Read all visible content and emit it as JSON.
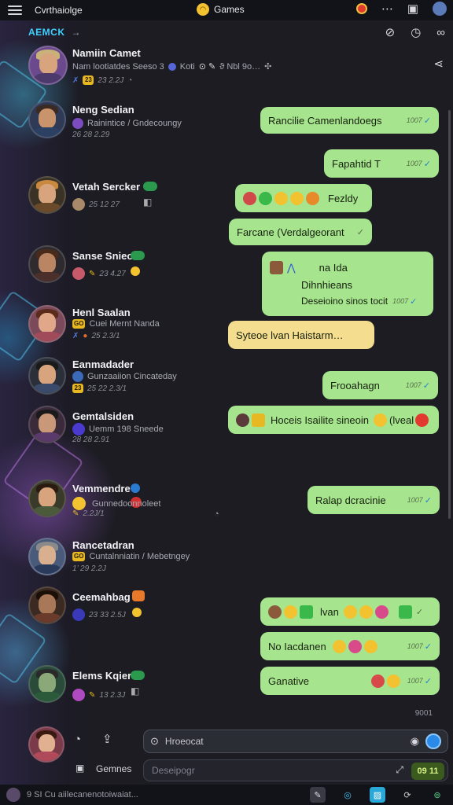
{
  "status_bar": {
    "app_name": "Cvrthaiolge",
    "center_title": "Games",
    "icons": [
      "menu-icon",
      "record-icon",
      "more-icon",
      "window-icon",
      "profile-icon"
    ]
  },
  "header": {
    "tag": "AEMCK",
    "tag_suffix": "→",
    "title": "Namiin Camet",
    "subtitle": "Nam lootiatdes Seeso 3",
    "subtitle_extra": "Koti",
    "subtitle_more": "ϑ Nbl 9o…",
    "meta": "23 2.2J",
    "icons": [
      "edit-icon",
      "clock-icon",
      "infinity-icon",
      "share-icon"
    ]
  },
  "contacts": [
    {
      "name": "Neng Sedian",
      "sub": "Rainintice / Gndecoungy",
      "meta": "26 28 2.29"
    },
    {
      "name": "Vetah Sercker",
      "sub": "",
      "meta": "25 12 27"
    },
    {
      "name": "Sanse Snieo",
      "sub": "",
      "meta": "23 4.27"
    },
    {
      "name": "Henl Saalan",
      "sub": "Cuei Mernt Nanda",
      "meta": "25 2.3/1"
    },
    {
      "name": "Eanmadader",
      "sub": "Gunzaaiion Cincateday",
      "meta": "25 22 2.3/1"
    },
    {
      "name": "Gemtalsiden",
      "sub": "Uemm 198 Sneede",
      "meta": "28 28 2.91"
    },
    {
      "name": "Vemmendre",
      "sub": "Gunnedoonnoleet",
      "meta": "2.2J/1"
    },
    {
      "name": "Rancetadran",
      "sub": "Cuntalnniatin / Mebetngey",
      "meta": "1’ 29 2.2J"
    },
    {
      "name": "Ceemahbag",
      "sub": "",
      "meta": "23 33 2.5J"
    },
    {
      "name": "Elems Kqier",
      "sub": "",
      "meta": "13 2.3J"
    }
  ],
  "messages": [
    {
      "text": "Rancilie Camenlandoegs",
      "time": "1007",
      "style": "green"
    },
    {
      "text": "Fapahtid T",
      "time": "1007",
      "style": "green"
    },
    {
      "text": "Fezldy",
      "time": "",
      "style": "green"
    },
    {
      "text": "Farcane (Verdalgeorant",
      "time": "",
      "style": "green"
    },
    {
      "text": "na Ida",
      "line2": "Dihnhieans",
      "line3": "Deseioino sinos  tocit",
      "time": "1007",
      "style": "green"
    },
    {
      "text": "Syteoe lvan Haistarm…",
      "time": "",
      "style": "yellow"
    },
    {
      "text": "Frooahagn",
      "time": "1007",
      "style": "green"
    },
    {
      "text": "Hoceis Isailite sineoin",
      "text2": "(lveal",
      "time": "",
      "style": "green"
    },
    {
      "text": "Ralap dcracinie",
      "time": "1007",
      "style": "green"
    },
    {
      "text": "lvan",
      "time": "",
      "style": "green"
    },
    {
      "text": "No Iacdanen",
      "time": "1007",
      "style": "green"
    },
    {
      "text": "Ganative",
      "time": "1007",
      "style": "green"
    }
  ],
  "timestamp_footer": "9001",
  "composer": {
    "search_placeholder": "Hroeocat",
    "games_label": "Gemnes",
    "message_placeholder": "Deseipogr",
    "send_label": "09 11"
  },
  "bottom_bar": {
    "text": "9 SI Cu aiilecanenotoiwaiat..."
  },
  "colors": {
    "bubble_green": "#a6e58e",
    "bubble_yellow": "#f4dd8e",
    "accent": "#3fd0ff",
    "background": "#1b1c22"
  }
}
